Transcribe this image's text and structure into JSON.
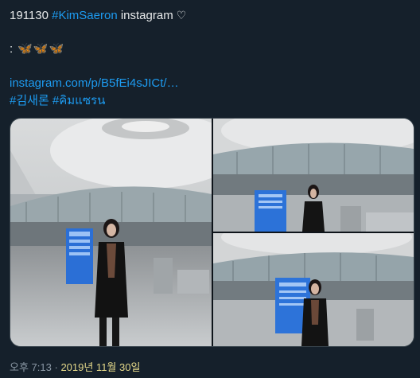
{
  "tweet": {
    "date_code": "191130",
    "hashtag_name": "#KimSaeron",
    "platform": "instagram",
    "heart_glyph": "♡",
    "prefix": ":",
    "butterflies": "🦋🦋🦋",
    "instagram_link": "instagram.com/p/B5fEi4sJICt/…",
    "hashtag_kr": "#김새론",
    "hashtag_th": "#คิมแซรน"
  },
  "media": {
    "photos": [
      "photo-1",
      "photo-2",
      "photo-3"
    ]
  },
  "meta": {
    "time": "오후 7:13",
    "separator": "·",
    "date": "2019년 11월 30일"
  }
}
